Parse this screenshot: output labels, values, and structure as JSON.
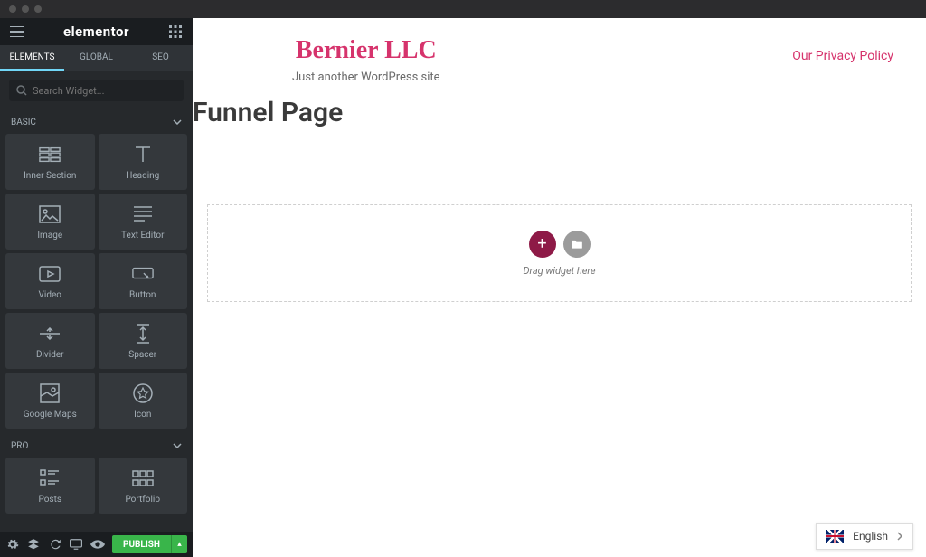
{
  "brand": "elementor",
  "tabs": {
    "elements": "Elements",
    "global": "Global",
    "seo": "SEO"
  },
  "search": {
    "placeholder": "Search Widget..."
  },
  "categories": {
    "basic": "Basic",
    "pro": "Pro"
  },
  "widgets": {
    "basic": [
      {
        "key": "inner-section",
        "label": "Inner Section"
      },
      {
        "key": "heading",
        "label": "Heading"
      },
      {
        "key": "image",
        "label": "Image"
      },
      {
        "key": "text-editor",
        "label": "Text Editor"
      },
      {
        "key": "video",
        "label": "Video"
      },
      {
        "key": "button",
        "label": "Button"
      },
      {
        "key": "divider",
        "label": "Divider"
      },
      {
        "key": "spacer",
        "label": "Spacer"
      },
      {
        "key": "google-maps",
        "label": "Google Maps"
      },
      {
        "key": "icon",
        "label": "Icon"
      }
    ],
    "pro": [
      {
        "key": "posts",
        "label": "Posts"
      },
      {
        "key": "portfolio",
        "label": "Portfolio"
      }
    ]
  },
  "footer": {
    "publish": "Publish"
  },
  "site": {
    "title": "Bernier LLC",
    "tagline": "Just another WordPress site",
    "nav_privacy": "Our Privacy Policy",
    "page_title": "Funnel Page"
  },
  "dropzone": {
    "hint": "Drag widget here"
  },
  "language": {
    "label": "English"
  },
  "colors": {
    "accent": "#d6336c",
    "publish": "#39b54a",
    "dz_add": "#8e1a47"
  }
}
